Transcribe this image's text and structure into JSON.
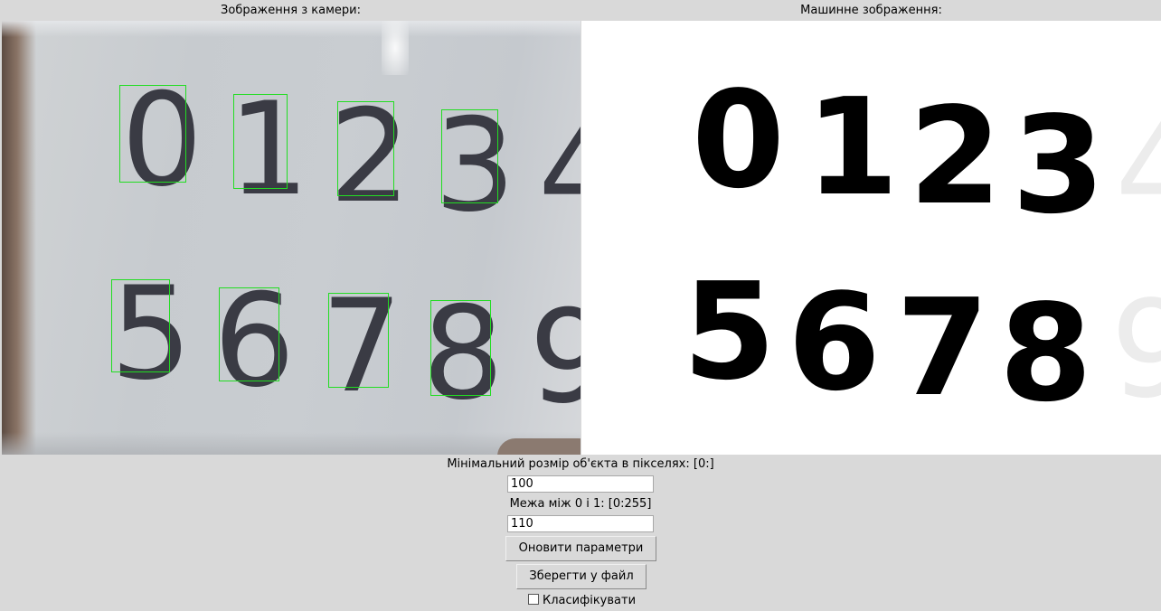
{
  "labels": {
    "camera": "Зображення з камери:",
    "machine": "Машинне зображення:"
  },
  "camera_digits": {
    "top": [
      "0",
      "1",
      "2",
      "3",
      "4"
    ],
    "bottom": [
      "5",
      "6",
      "7",
      "8",
      "9"
    ]
  },
  "machine_digits": {
    "top": [
      "0",
      "1",
      "2",
      "3"
    ],
    "bottom": [
      "5",
      "6",
      "7",
      "8"
    ],
    "ghost_top": "4",
    "ghost_bottom": "9"
  },
  "controls": {
    "min_size_label": "Мінімальний розмір об'єкта в пікселях:  [0:]",
    "min_size_value": "100",
    "threshold_label": "Межа між 0 і 1:  [0:255]",
    "threshold_value": "110",
    "update_button": "Оновити параметри",
    "save_button": "Зберегти у файл",
    "classify_label": "Класифікувати",
    "classify_checked": false
  },
  "colors": {
    "background": "#d9d9d9",
    "detection_box": "#22dd22"
  }
}
